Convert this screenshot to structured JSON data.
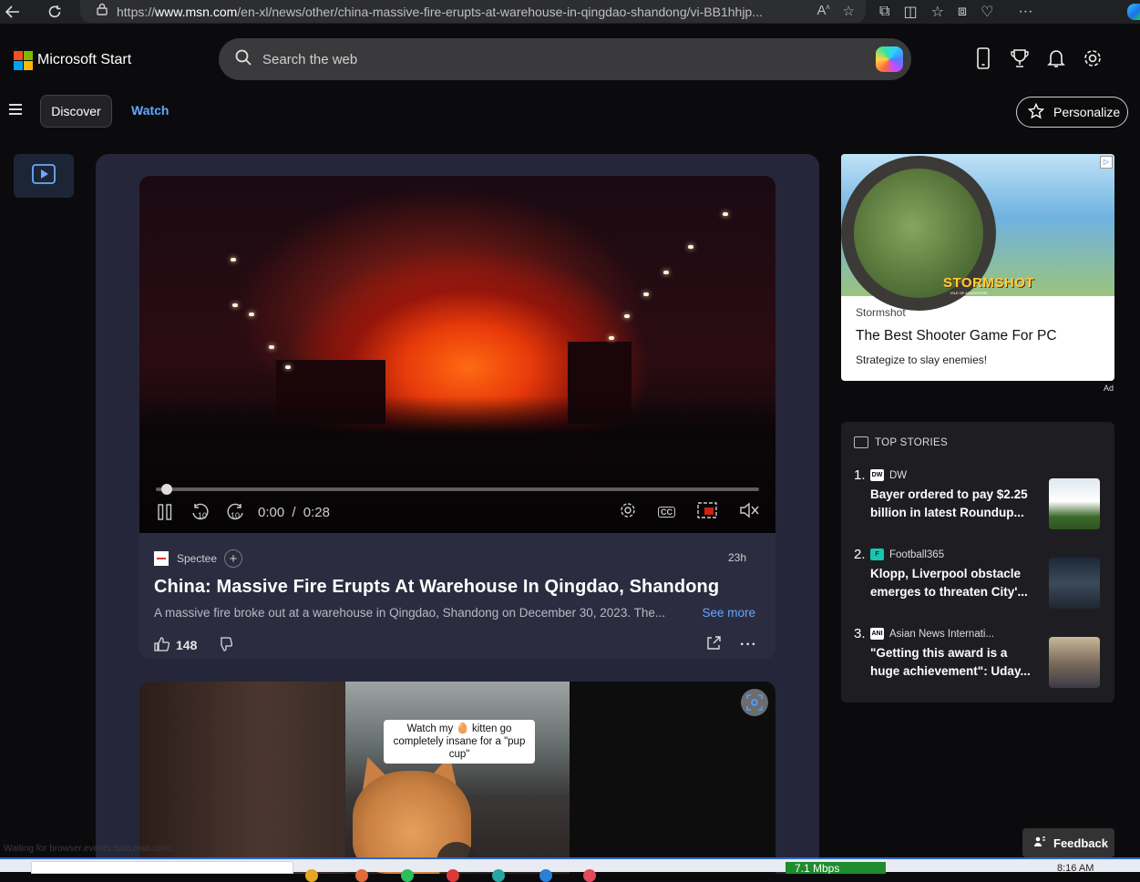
{
  "browser": {
    "url_prefix": "https://",
    "url_domain": "www.msn.com",
    "url_path": "/en-xl/news/other/china-massive-fire-erupts-at-warehouse-in-qingdao-shandong/vi-BB1hhjp..."
  },
  "header": {
    "brand": "Microsoft Start",
    "search_placeholder": "Search the web"
  },
  "subnav": {
    "discover": "Discover",
    "watch": "Watch",
    "personalize": "Personalize"
  },
  "video_card": {
    "player": {
      "current_time": "0:00",
      "separator": "/",
      "duration": "0:28",
      "skip_back": "10",
      "skip_forward": "10",
      "cc": "CC",
      "progress": 0.0
    },
    "source": "Spectee",
    "age": "23h",
    "headline": "China: Massive Fire Erupts At Warehouse In Qingdao, Shandong",
    "summary": "A massive fire broke out at a warehouse in Qingdao, Shandong on December 30, 2023. The...",
    "see_more": "See more",
    "likes": "148"
  },
  "second_card": {
    "caption": "Watch my 🥚 kitten go completely insane for a \"pup cup\""
  },
  "ad": {
    "advertiser": "Stormshot",
    "title": "The Best Shooter Game For PC",
    "subtitle": "Strategize to slay enemies!",
    "brand_art": "STORMSHOT",
    "brand_art_sub": "ISLE OF ADVENTURE",
    "label": "Ad"
  },
  "top_stories": {
    "heading": "TOP STORIES",
    "items": [
      {
        "num": "1.",
        "source": "DW",
        "logo": "DW",
        "logo_color": "#ffffff",
        "title": "Bayer ordered to pay $2.25 billion in latest Roundup...",
        "thumb_color": "#3e6b2a"
      },
      {
        "num": "2.",
        "source": "Football365",
        "logo": "F",
        "logo_color": "#18c6b0",
        "title": "Klopp, Liverpool obstacle emerges to threaten City'...",
        "thumb_color": "#2d3a4a"
      },
      {
        "num": "3.",
        "source": "Asian News Internati...",
        "logo": "ANI",
        "logo_color": "#ffffff",
        "title": "\"Getting this award is a huge achievement\": Uday...",
        "thumb_color": "#7a6a5a"
      }
    ]
  },
  "feedback": "Feedback",
  "status_text": "Waiting for browser.events.data.msn.com...",
  "taskbar": {
    "network_speed": "7.1 Mbps",
    "clock": "8:16 AM"
  },
  "colors": {
    "accent_link": "#61a8ff",
    "feed_bg": "#26263a",
    "card_bg": "#2c2c40"
  }
}
